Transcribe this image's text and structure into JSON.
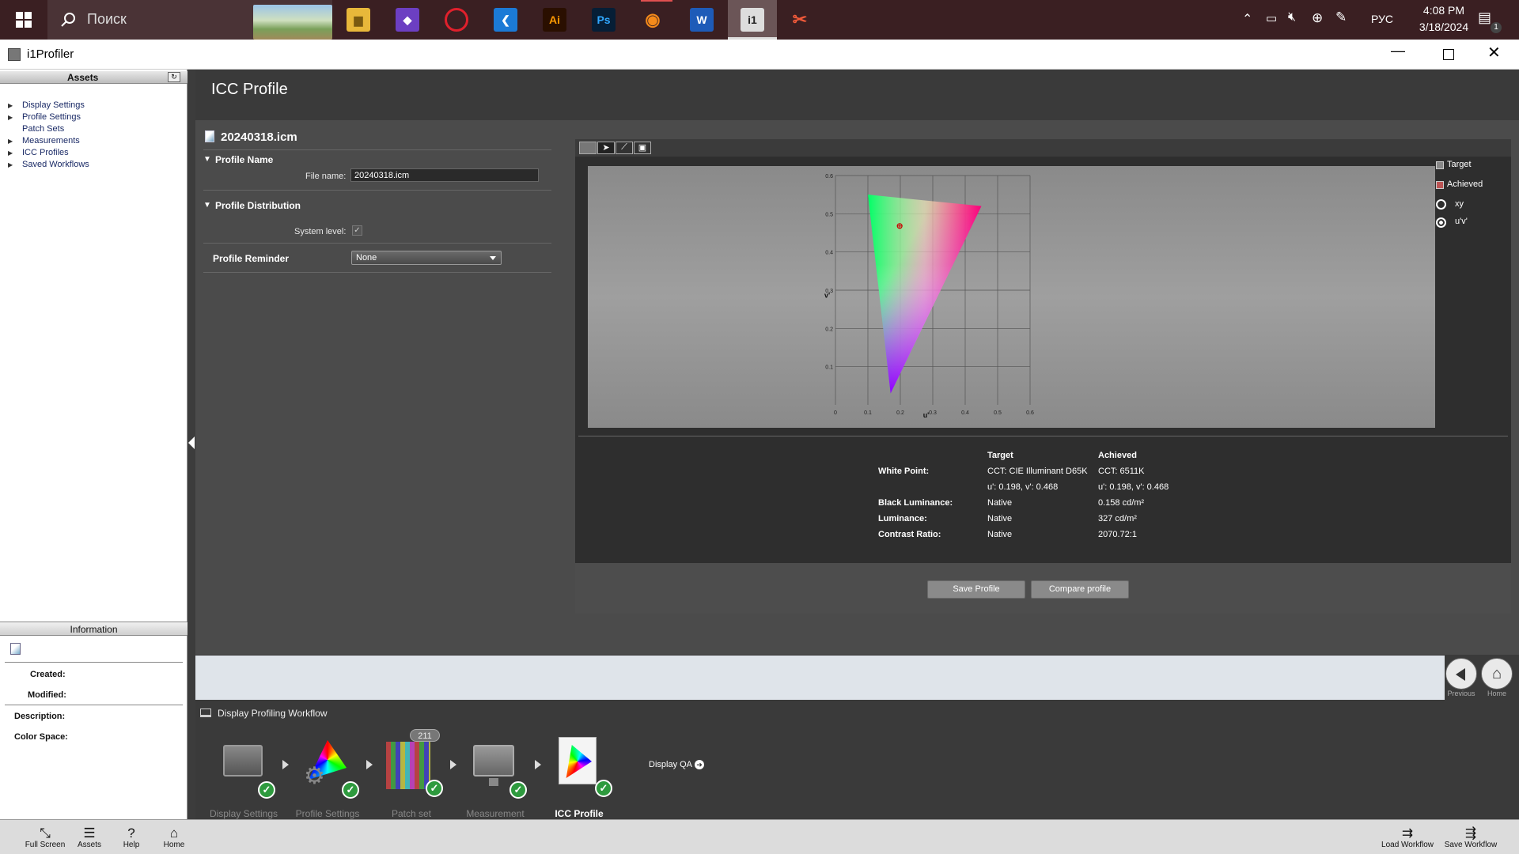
{
  "taskbar": {
    "search_placeholder": "Поиск",
    "language": "РУС",
    "time": "4:08 PM",
    "date": "3/18/2024",
    "notification_count": "1",
    "apps": [
      "file-explorer",
      "visual-studio",
      "opera",
      "vscode",
      "illustrator",
      "photoshop",
      "blender",
      "word",
      "i1profiler",
      "snipping-tool"
    ]
  },
  "window": {
    "title": "i1Profiler"
  },
  "assets": {
    "header": "Assets",
    "items": [
      {
        "label": "Display Settings",
        "expandable": true
      },
      {
        "label": "Profile Settings",
        "expandable": true
      },
      {
        "label": "Patch Sets",
        "expandable": false
      },
      {
        "label": "Measurements",
        "expandable": true
      },
      {
        "label": "ICC Profiles",
        "expandable": true
      },
      {
        "label": "Saved Workflows",
        "expandable": true
      }
    ]
  },
  "information": {
    "header": "Information",
    "created_label": "Created:",
    "modified_label": "Modified:",
    "description_label": "Description:",
    "color_space_label": "Color Space:"
  },
  "page": {
    "title": "ICC Profile"
  },
  "profile": {
    "filename": "20240318.icm",
    "name_section": "Profile Name",
    "file_name_label": "File name:",
    "file_name_value": "20240318.icm",
    "distribution_section": "Profile Distribution",
    "system_level_label": "System level:",
    "system_level_checked": true,
    "reminder_label": "Profile Reminder",
    "reminder_value": "None"
  },
  "chart_legend": {
    "target": "Target",
    "achieved": "Achieved",
    "xy": "xy",
    "uv": "u'v'",
    "selected": "u'v'"
  },
  "chart_data": {
    "type": "scatter",
    "xlabel": "u'",
    "ylabel": "v'",
    "xlim": [
      0,
      0.6
    ],
    "ylim": [
      0,
      0.6
    ],
    "x_ticks": [
      "0",
      "0.1",
      "0.2",
      "0.3",
      "0.4",
      "0.5",
      "0.6"
    ],
    "y_ticks": [
      "0.1",
      "0.2",
      "0.3",
      "0.4",
      "0.5",
      "0.6"
    ],
    "grid": true,
    "gamut_triangle": {
      "u": [
        0.45,
        0.1,
        0.17
      ],
      "v": [
        0.52,
        0.55,
        0.03
      ]
    },
    "white_point": {
      "u": 0.198,
      "v": 0.468
    }
  },
  "results": {
    "col_target": "Target",
    "col_achieved": "Achieved",
    "rows": [
      {
        "label": "White Point:",
        "target": "CCT: CIE Illuminant D65K",
        "achieved": "CCT: 6511K"
      },
      {
        "label": "",
        "target": "u': 0.198, v': 0.468",
        "achieved": "u': 0.198, v': 0.468"
      },
      {
        "label": "Black Luminance:",
        "target": "Native",
        "achieved": "0.158 cd/m²"
      },
      {
        "label": "Luminance:",
        "target": "Native",
        "achieved": "327 cd/m²"
      },
      {
        "label": "Contrast Ratio:",
        "target": "Native",
        "achieved": "2070.72:1"
      }
    ]
  },
  "actions": {
    "save": "Save Profile",
    "compare": "Compare profile"
  },
  "nav": {
    "previous": "Previous",
    "home": "Home"
  },
  "workflow": {
    "title": "Display Profiling Workflow",
    "patch_count": "211",
    "steps": [
      {
        "label": "Display Settings",
        "done": true
      },
      {
        "label": "Profile Settings",
        "done": true
      },
      {
        "label": "Patch set",
        "done": true
      },
      {
        "label": "Measurement",
        "done": true
      },
      {
        "label": "ICC Profile",
        "done": true,
        "active": true
      }
    ],
    "next_label": "Display QA"
  },
  "bottom": {
    "full_screen": "Full Screen",
    "assets": "Assets",
    "help": "Help",
    "home": "Home",
    "load_workflow": "Load Workflow",
    "save_workflow": "Save Workflow"
  }
}
